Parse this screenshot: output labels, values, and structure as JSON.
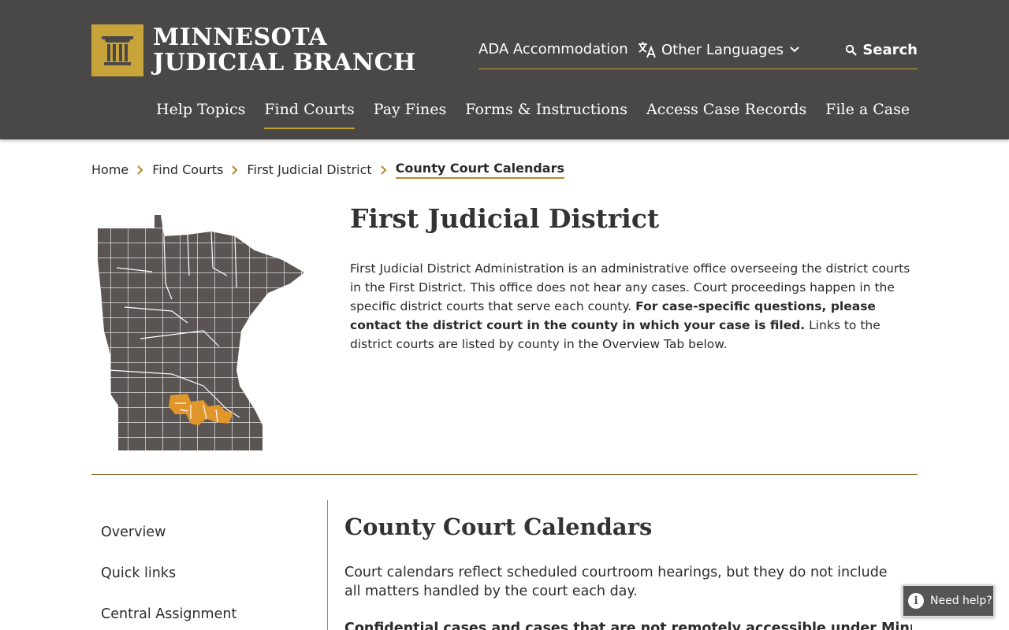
{
  "header": {
    "logo": {
      "line1": "MINNESOTA",
      "line2": "JUDICIAL BRANCH"
    },
    "utility": {
      "ada_label": "ADA Accommodation",
      "languages_label": "Other Languages",
      "search_label": "Search"
    },
    "nav": [
      {
        "label": "Help Topics",
        "active": false
      },
      {
        "label": "Find Courts",
        "active": true
      },
      {
        "label": "Pay Fines",
        "active": false
      },
      {
        "label": "Forms & Instructions",
        "active": false
      },
      {
        "label": "Access Case Records",
        "active": false
      },
      {
        "label": "File a Case",
        "active": false
      }
    ]
  },
  "breadcrumb": {
    "items": [
      "Home",
      "Find Courts",
      "First Judicial District"
    ],
    "current": "County Court Calendars"
  },
  "intro": {
    "title": "First Judicial District",
    "text_part1": "First Judicial District Administration is an administrative office overseeing the district courts in the First District. This office does not hear any cases. Court proceedings happen in the specific district courts that serve each county. ",
    "text_bold": "For case-specific questions, please contact the district court in the county in which your case is filed.",
    "text_part2": " Links to the district courts are listed by county in the Overview Tab below."
  },
  "sidenav": {
    "items": [
      "Overview",
      "Quick links",
      "Central Assignment"
    ]
  },
  "content": {
    "title": "County Court Calendars",
    "text": "Court calendars reflect scheduled courtroom hearings, but they do not include all matters handled by the court each day.",
    "bold_text": "Confidential cases and cases that are not remotely accessible under Minn. R."
  },
  "help_widget": {
    "label": "Need help?"
  },
  "colors": {
    "header_bg": "#4a4847",
    "accent_gold": "#c8a33a",
    "map_gray": "#5a5553",
    "map_highlight": "#e0962a"
  }
}
